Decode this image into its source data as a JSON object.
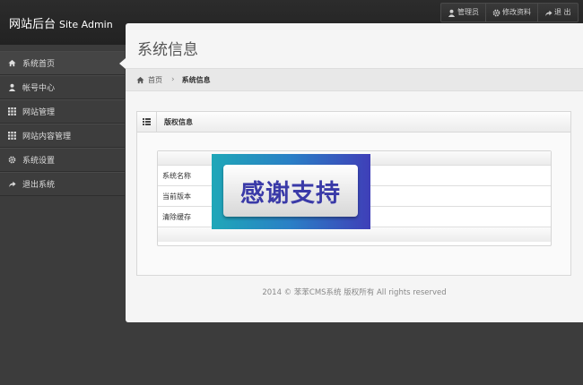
{
  "header": {
    "brand_cn": "网站后台",
    "brand_en": "Site Admin",
    "nav": [
      {
        "label": "管理员",
        "icon": "user-icon"
      },
      {
        "label": "修改资料",
        "icon": "gear-icon"
      },
      {
        "label": "退 出",
        "icon": "share-arrow-icon"
      }
    ]
  },
  "sidebar": {
    "items": [
      {
        "label": "系统首页",
        "icon": "home-icon"
      },
      {
        "label": "帐号中心",
        "icon": "user-icon"
      },
      {
        "label": "网站管理",
        "icon": "grid-icon"
      },
      {
        "label": "网站内容管理",
        "icon": "grid-icon"
      },
      {
        "label": "系统设置",
        "icon": "gear-icon"
      },
      {
        "label": "退出系统",
        "icon": "share-arrow-icon"
      }
    ]
  },
  "main": {
    "title": "系统信息",
    "breadcrumb": {
      "home": "首页",
      "current": "系统信息"
    },
    "panel": {
      "title": "版权信息",
      "rows": [
        "系统名称",
        "当前版本",
        "清除缓存"
      ]
    },
    "banner": "感谢支持",
    "footer": "2014 © 苯苯CMS系统 版权所有 All rights reserved"
  },
  "colors": {
    "page_bg": "#3c3c3c",
    "panel_bg": "#f5f5f5",
    "banner_text": "#3a3aa8"
  }
}
